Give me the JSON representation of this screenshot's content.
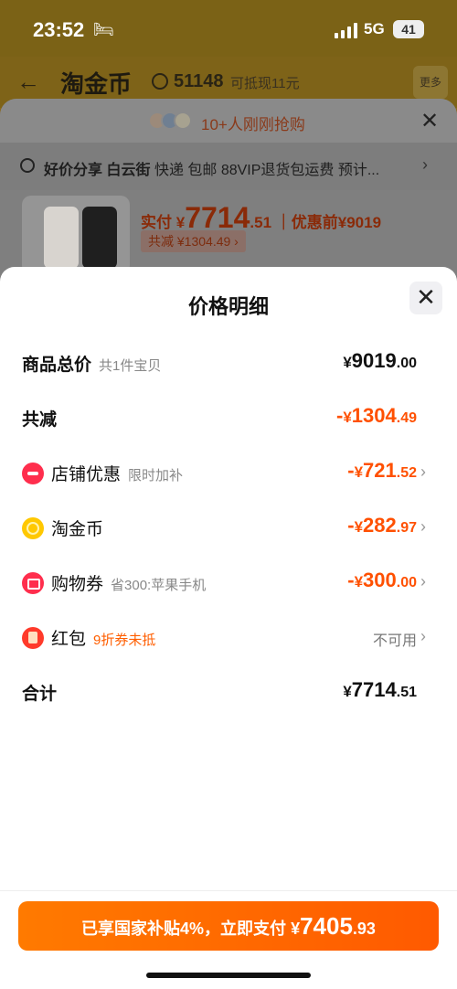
{
  "status_bar": {
    "time": "23:52",
    "network": "5G",
    "battery": "41"
  },
  "background_page": {
    "logo": "淘金币",
    "coin_count": "51148",
    "subtitle": "可抵现11元",
    "more_label": "更多",
    "rush_text": "10+人刚刚抢购",
    "shipping": {
      "tag": "好价分享",
      "location": "白云街",
      "details": "快递 包邮 88VIP退货包运费 预计..."
    },
    "product": {
      "paid_label": "实付",
      "currency": "¥",
      "paid_int": "7714",
      "paid_dec": ".51",
      "before_label": "优惠前",
      "before_value": "¥9019",
      "saved_pill": "共减 ¥1304.49 ›"
    }
  },
  "sheet": {
    "title": "价格明细",
    "rows": [
      {
        "label": "商品总价",
        "note": "共1件宝贝",
        "prefix": "",
        "currency": "¥",
        "int": "9019",
        "dec": ".00"
      },
      {
        "label": "共减",
        "note": "",
        "prefix": "-",
        "currency": "¥",
        "int": "1304",
        "dec": ".49"
      },
      {
        "label": "店铺优惠",
        "note": "限时加补",
        "prefix": "-",
        "currency": "¥",
        "int": "721",
        "dec": ".52"
      },
      {
        "label": "淘金币",
        "note": "",
        "prefix": "-",
        "currency": "¥",
        "int": "282",
        "dec": ".97"
      },
      {
        "label": "购物券",
        "note": "省300:苹果手机",
        "prefix": "-",
        "currency": "¥",
        "int": "300",
        "dec": ".00"
      },
      {
        "label": "红包",
        "note": "9折券未抵",
        "value_text": "不可用"
      },
      {
        "label": "合计",
        "note": "",
        "prefix": "",
        "currency": "¥",
        "int": "7714",
        "dec": ".51"
      }
    ]
  },
  "pay_button": {
    "text": "已享国家补贴4%，立即支付",
    "currency": "¥",
    "int": "7405",
    "dec": ".93"
  },
  "colors": {
    "accent": "#ff5e00",
    "discount": "#ff5000"
  },
  "icons": [
    "back-arrow-icon",
    "coin-icon",
    "location-pin-icon",
    "close-icon",
    "shop-discount-icon",
    "gold-coin-icon",
    "coupon-ticket-icon",
    "red-packet-icon",
    "chevron-right-icon"
  ]
}
